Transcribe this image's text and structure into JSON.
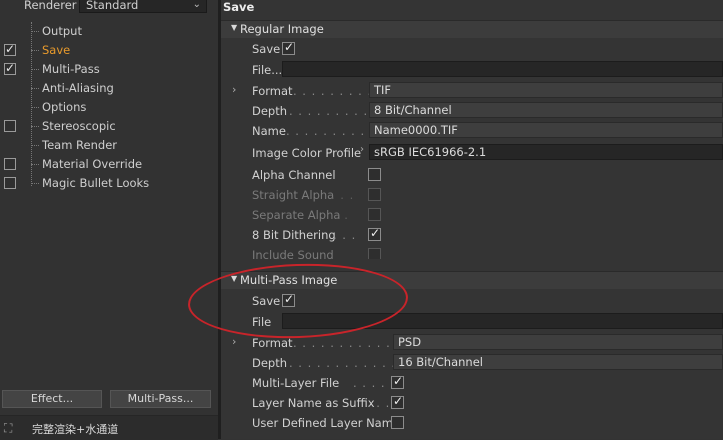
{
  "left_panel": {
    "renderer_label": "Renderer",
    "renderer_value": "Standard",
    "tree_items": [
      {
        "label": "Output",
        "checkbox": false,
        "checked": false,
        "active": false
      },
      {
        "label": "Save",
        "checkbox": true,
        "checked": true,
        "active": true
      },
      {
        "label": "Multi-Pass",
        "checkbox": true,
        "checked": true,
        "active": false
      },
      {
        "label": "Anti-Aliasing",
        "checkbox": false,
        "checked": false,
        "active": false
      },
      {
        "label": "Options",
        "checkbox": false,
        "checked": false,
        "active": false
      },
      {
        "label": "Stereoscopic",
        "checkbox": true,
        "checked": false,
        "active": false
      },
      {
        "label": "Team Render",
        "checkbox": false,
        "checked": false,
        "active": false
      },
      {
        "label": "Material Override",
        "checkbox": true,
        "checked": false,
        "active": false
      },
      {
        "label": "Magic Bullet Looks",
        "checkbox": true,
        "checked": false,
        "active": false
      }
    ],
    "effect_button": "Effect...",
    "multipass_button": "Multi-Pass...",
    "status_text": "完整渲染+水通道"
  },
  "right_panel": {
    "title": "Save",
    "regular": {
      "heading": "Regular Image",
      "save_label": "Save",
      "save_checked": true,
      "file_label": "File...",
      "file_value": "",
      "format_label": "Format",
      "format_value": "TIF",
      "depth_label": "Depth",
      "depth_value": "8 Bit/Channel",
      "name_label": "Name",
      "name_value": "Name0000.TIF",
      "profile_label": "Image Color Profile",
      "profile_value": "sRGB IEC61966-2.1",
      "alpha_label": "Alpha Channel",
      "straight_label": "Straight Alpha",
      "separate_label": "Separate Alpha",
      "dither_label": "8 Bit Dithering",
      "dither_checked": true,
      "sound_label": "Include Sound"
    },
    "multipass": {
      "heading": "Multi-Pass Image",
      "save_label": "Save",
      "save_checked": true,
      "file_label": "File",
      "file_value": "",
      "format_label": "Format",
      "format_value": "PSD",
      "depth_label": "Depth",
      "depth_value": "16 Bit/Channel",
      "layer_file_label": "Multi-Layer File",
      "layer_file_checked": true,
      "suffix_label": "Layer Name as Suffix",
      "suffix_checked": true,
      "user_defined_label": "User Defined Layer Name",
      "user_defined_checked": false
    }
  },
  "colors": {
    "active_item": "#e89a2c",
    "annotation": "#c8242a"
  }
}
